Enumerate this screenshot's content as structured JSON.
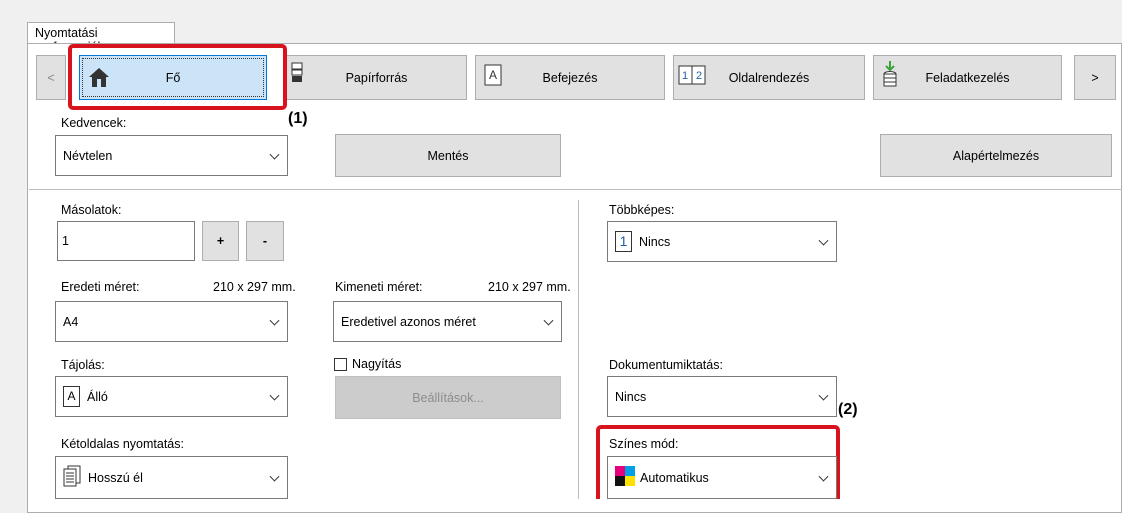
{
  "window": {
    "tab_title": "Nyomtatási preferenciák"
  },
  "tabs": [
    {
      "label": "Fő",
      "icon": "home-icon",
      "selected": true
    },
    {
      "label": "Papírforrás",
      "icon": "paper-tray-icon"
    },
    {
      "label": "Befejezés",
      "icon": "finishing-page-icon"
    },
    {
      "label": "Oldalrendezés",
      "icon": "layout-1-2-icon"
    },
    {
      "label": "Feladatkezelés",
      "icon": "job-stack-icon"
    }
  ],
  "nav": {
    "prev": "<",
    "next": ">"
  },
  "favorites": {
    "label": "Kedvencek:",
    "value": "Névtelen",
    "save": "Mentés",
    "defaults": "Alapértelmezés"
  },
  "copies": {
    "label": "Másolatok:",
    "value": "1",
    "plus": "+",
    "minus": "-"
  },
  "original_size": {
    "label": "Eredeti méret:",
    "dims": "210 x 297 mm.",
    "value": "A4"
  },
  "output_size": {
    "label": "Kimeneti méret:",
    "dims": "210 x 297 mm.",
    "value": "Eredetivel azonos méret"
  },
  "orientation": {
    "label": "Tájolás:",
    "value": "Álló",
    "icon_glyph": "A"
  },
  "zoom": {
    "label": "Nagyítás",
    "checked": false,
    "settings": "Beállítások..."
  },
  "duplex": {
    "label": "Kétoldalas nyomtatás:",
    "value": "Hosszú él"
  },
  "nup": {
    "label": "Többképes:",
    "value": "Nincs",
    "icon_glyph": "1"
  },
  "stamp": {
    "label": "Dokumentumiktatás:",
    "value": "Nincs"
  },
  "color_mode": {
    "label": "Színes mód:",
    "value": "Automatikus"
  },
  "callouts": {
    "one": "(1)",
    "two": "(2)"
  },
  "colors": {
    "highlight": "#d7141e",
    "selected_tab": "#cce4f7"
  }
}
